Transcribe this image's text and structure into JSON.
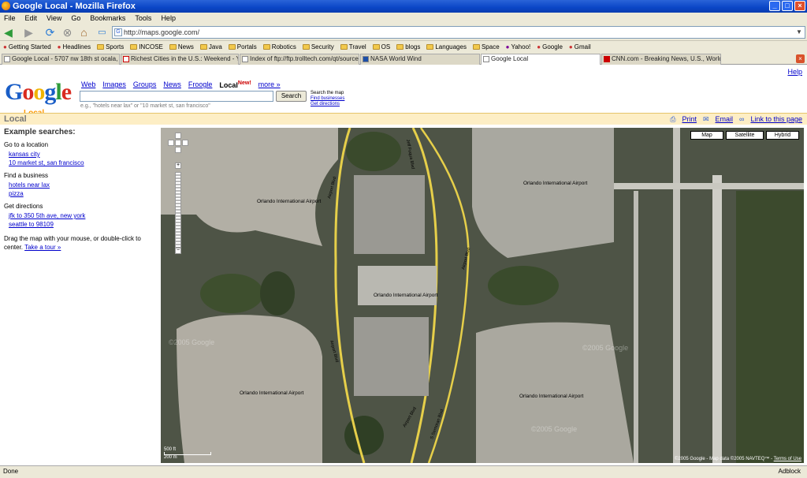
{
  "window": {
    "title": "Google Local - Mozilla Firefox"
  },
  "menubar": [
    "File",
    "Edit",
    "View",
    "Go",
    "Bookmarks",
    "Tools",
    "Help"
  ],
  "navbar": {
    "url": "http://maps.google.com/"
  },
  "bookmarks": [
    {
      "label": "Getting Started",
      "icon": "getting-started-icon"
    },
    {
      "label": "Headlines",
      "icon": "rss-icon"
    },
    {
      "label": "Sports",
      "icon": "folder-icon"
    },
    {
      "label": "INCOSE",
      "icon": "folder-icon"
    },
    {
      "label": "News",
      "icon": "folder-icon"
    },
    {
      "label": "Java",
      "icon": "folder-icon"
    },
    {
      "label": "Portals",
      "icon": "folder-icon"
    },
    {
      "label": "Robotics",
      "icon": "folder-icon"
    },
    {
      "label": "Security",
      "icon": "folder-icon"
    },
    {
      "label": "Travel",
      "icon": "folder-icon"
    },
    {
      "label": "OS",
      "icon": "folder-icon"
    },
    {
      "label": "blogs",
      "icon": "folder-icon"
    },
    {
      "label": "Languages",
      "icon": "folder-icon"
    },
    {
      "label": "Space",
      "icon": "folder-icon"
    },
    {
      "label": "Yahoo!",
      "icon": "yahoo-icon"
    },
    {
      "label": "Google",
      "icon": "google-icon"
    },
    {
      "label": "Gmail",
      "icon": "gmail-icon"
    }
  ],
  "tabs": [
    {
      "label": "Google Local - 5707 nw 18th st ocala, fl, 34..."
    },
    {
      "label": "Richest Cities in the U.S.: Weekend - Yahoo..."
    },
    {
      "label": "Index of ftp://ftp.trolltech.com/qt/source/"
    },
    {
      "label": "NASA World Wind"
    },
    {
      "label": "Google Local"
    },
    {
      "label": "CNN.com - Breaking News, U.S., World, We..."
    }
  ],
  "page": {
    "help": "Help",
    "logo": {
      "word": "Google",
      "sub": "Local",
      "colors": [
        "#1a5ec7",
        "#d92b20",
        "#f0b400",
        "#1a5ec7",
        "#2e9b3a",
        "#d92b20"
      ]
    },
    "gnav": [
      {
        "label": "Web",
        "current": false
      },
      {
        "label": "Images",
        "current": false
      },
      {
        "label": "Groups",
        "current": false
      },
      {
        "label": "News",
        "current": false
      },
      {
        "label": "Froogle",
        "current": false
      },
      {
        "label": "Local",
        "current": true,
        "badge": "New!"
      },
      {
        "label": "more »",
        "current": false
      }
    ],
    "search": {
      "value": "",
      "button": "Search",
      "hint": "e.g., \"hotels near lax\" or \"10 market st, san francisco\"",
      "options_title": "Search the map",
      "find_businesses": "Find businesses",
      "get_directions": "Get directions"
    },
    "section_title": "Local",
    "tools": {
      "print": "Print",
      "email": "Email",
      "link": "Link to this page"
    },
    "sidebar": {
      "heading": "Example searches:",
      "groups": [
        {
          "title": "Go to a location",
          "links": [
            "kansas city",
            "10 market st, san francisco"
          ]
        },
        {
          "title": "Find a business",
          "links": [
            "hotels near lax",
            "pizza"
          ]
        },
        {
          "title": "Get directions",
          "links": [
            "jfk to 350 5th ave, new york",
            "seattle to 98109"
          ]
        }
      ],
      "tip": "Drag the map with your mouse, or double-click to center.",
      "tour": "Take a tour »"
    },
    "map": {
      "types": [
        "Map",
        "Satellite",
        "Hybrid"
      ],
      "scale": {
        "ft": "500 ft",
        "m": "200 m"
      },
      "copyright": "©2005 Google - Map data ©2005 NAVTEQ™ -",
      "terms": "Terms of Use",
      "labels": [
        "Orlando International Airport",
        "Orlando International Airport",
        "Orlando International Airport",
        "Orlando International Airport",
        "Orlando International Airport"
      ],
      "roads": [
        "Airport Blvd",
        "Airport Blvd",
        "Airport Blvd",
        "S Semoran Blvd",
        "Jeff Fuqua Blvd",
        "Airport Blvd"
      ],
      "watermark": "©2005 Google"
    }
  },
  "statusbar": {
    "left": "Done",
    "right": "Adblock"
  }
}
